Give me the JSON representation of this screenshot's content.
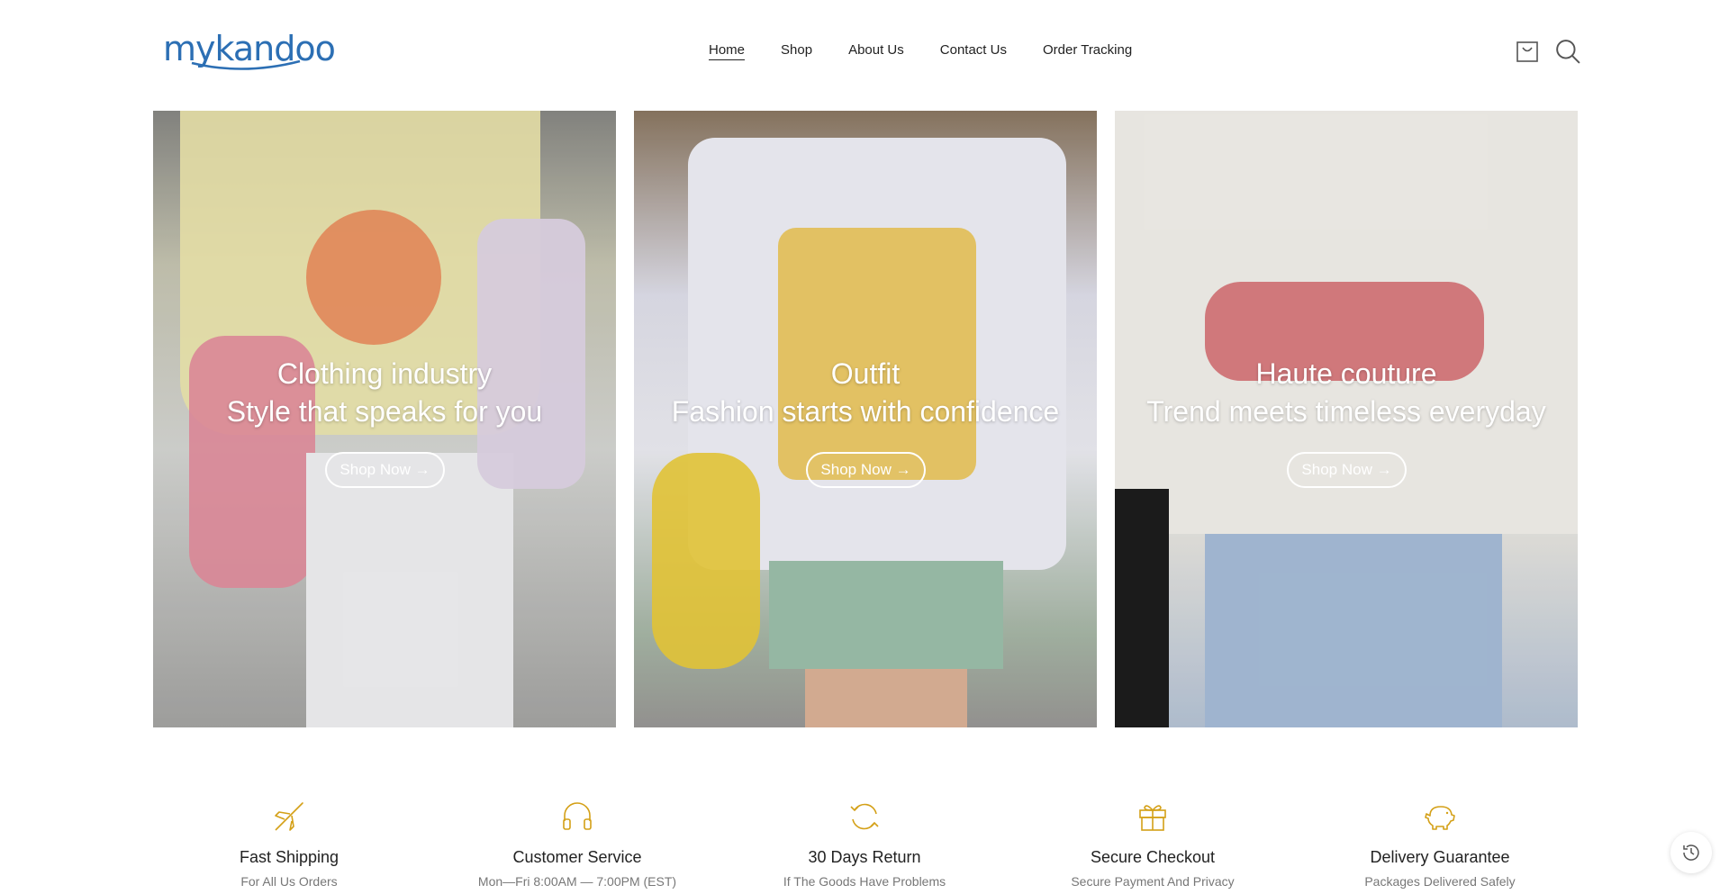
{
  "brand": {
    "name": "mykandoo",
    "color": "#2c6fb4"
  },
  "nav": {
    "items": [
      {
        "label": "Home",
        "active": true
      },
      {
        "label": "Shop",
        "active": false
      },
      {
        "label": "About Us",
        "active": false
      },
      {
        "label": "Contact Us",
        "active": false
      },
      {
        "label": "Order Tracking",
        "active": false
      }
    ]
  },
  "header_icons": [
    "shopping-bag-icon",
    "search-icon"
  ],
  "banners": [
    {
      "title": "Clothing industry",
      "subtitle": "Style that speaks for you",
      "button_label": "Shop Now →"
    },
    {
      "title": "Outfit",
      "subtitle": "Fashion starts with confidence",
      "button_label": "Shop Now →"
    },
    {
      "title": "Haute couture",
      "subtitle": "Trend meets timeless everyday",
      "button_label": "Shop Now →"
    }
  ],
  "features": [
    {
      "icon": "airplane-icon",
      "title": "Fast Shipping",
      "subtitle": "For All Us Orders"
    },
    {
      "icon": "headphones-icon",
      "title": "Customer Service",
      "subtitle": "Mon—Fri 8:00AM — 7:00PM (EST)"
    },
    {
      "icon": "return-arrows-icon",
      "title": "30 Days Return",
      "subtitle": "If The Goods Have Problems"
    },
    {
      "icon": "gift-icon",
      "title": "Secure Checkout",
      "subtitle": "Secure Payment And Privacy"
    },
    {
      "icon": "piggy-bank-icon",
      "title": "Delivery Guarantee",
      "subtitle": "Packages Delivered Safely"
    }
  ],
  "accent_color": "#d4a017",
  "history_icon": "history-clock-icon"
}
